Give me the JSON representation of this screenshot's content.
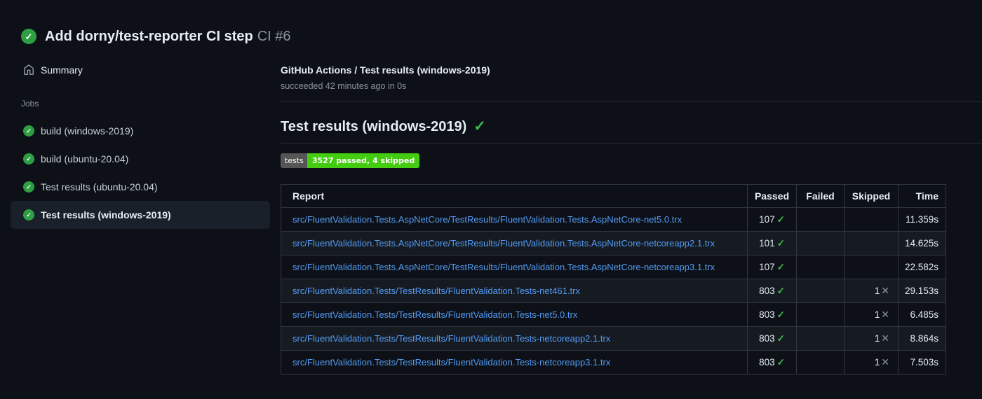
{
  "colors": {
    "bg": "#0d1117",
    "text": "#e6edf3",
    "muted": "#8b949e",
    "link": "#539bf5",
    "green": "#3fb950",
    "circle-green": "#2ea043",
    "border": "#30363d",
    "divider": "#262c33",
    "row-even": "#161b22",
    "active-bg": "#1a2029",
    "badge-label": "#555555",
    "badge-value": "#44cc11",
    "cross": "#8b949e"
  },
  "icons": {
    "check": "✓",
    "cross": "✕"
  },
  "header": {
    "status_icon": "check-circle",
    "title": "Add dorny/test-reporter CI step",
    "run_number": "CI #6"
  },
  "sidebar": {
    "summary_label": "Summary",
    "jobs_label": "Jobs",
    "jobs": [
      {
        "label": "build (windows-2019)",
        "status": "success",
        "active": false
      },
      {
        "label": "build (ubuntu-20.04)",
        "status": "success",
        "active": false
      },
      {
        "label": "Test results (ubuntu-20.04)",
        "status": "success",
        "active": false
      },
      {
        "label": "Test results (windows-2019)",
        "status": "success",
        "active": true
      }
    ]
  },
  "main": {
    "breadcrumb": "GitHub Actions / Test results (windows-2019)",
    "status_line": "succeeded 42 minutes ago in 0s",
    "heading": "Test results (windows-2019)",
    "badge": {
      "label": "tests",
      "value": "3527 passed, 4 skipped"
    },
    "table": {
      "columns": [
        "Report",
        "Passed",
        "Failed",
        "Skipped",
        "Time"
      ],
      "rows": [
        {
          "report": "src/FluentValidation.Tests.AspNetCore/TestResults/FluentValidation.Tests.AspNetCore-net5.0.trx",
          "passed": "107",
          "failed": "",
          "skipped": "",
          "time": "11.359s"
        },
        {
          "report": "src/FluentValidation.Tests.AspNetCore/TestResults/FluentValidation.Tests.AspNetCore-netcoreapp2.1.trx",
          "passed": "101",
          "failed": "",
          "skipped": "",
          "time": "14.625s"
        },
        {
          "report": "src/FluentValidation.Tests.AspNetCore/TestResults/FluentValidation.Tests.AspNetCore-netcoreapp3.1.trx",
          "passed": "107",
          "failed": "",
          "skipped": "",
          "time": "22.582s"
        },
        {
          "report": "src/FluentValidation.Tests/TestResults/FluentValidation.Tests-net461.trx",
          "passed": "803",
          "failed": "",
          "skipped": "1",
          "time": "29.153s"
        },
        {
          "report": "src/FluentValidation.Tests/TestResults/FluentValidation.Tests-net5.0.trx",
          "passed": "803",
          "failed": "",
          "skipped": "1",
          "time": "6.485s"
        },
        {
          "report": "src/FluentValidation.Tests/TestResults/FluentValidation.Tests-netcoreapp2.1.trx",
          "passed": "803",
          "failed": "",
          "skipped": "1",
          "time": "8.864s"
        },
        {
          "report": "src/FluentValidation.Tests/TestResults/FluentValidation.Tests-netcoreapp3.1.trx",
          "passed": "803",
          "failed": "",
          "skipped": "1",
          "time": "7.503s"
        }
      ]
    }
  }
}
